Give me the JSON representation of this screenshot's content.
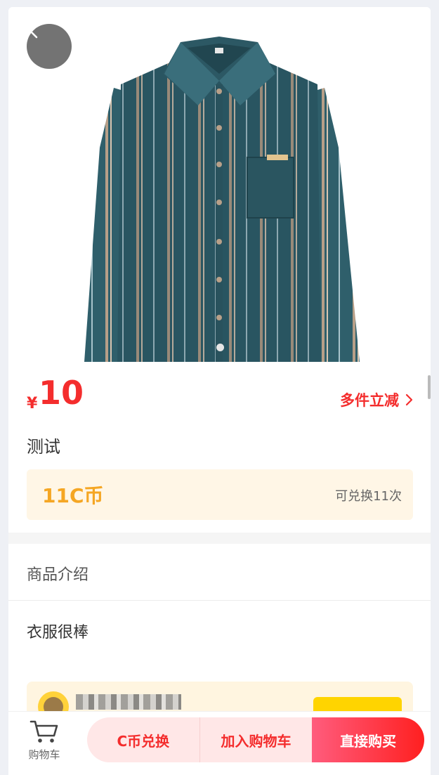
{
  "product": {
    "currency_symbol": "¥",
    "price": "10",
    "promo_label": "多件立减",
    "title": "测试",
    "coin_price": "11C币",
    "coin_exchange_note": "可兑换11次"
  },
  "gallery": {
    "image_name": "striped-shirt-photo",
    "dots": 1
  },
  "details": {
    "section_title": "商品介绍",
    "description": "衣服很棒"
  },
  "bottom_bar": {
    "cart_label": "购物车",
    "coin_exchange_label": "C币兑换",
    "add_to_cart_label": "加入购物车",
    "buy_now_label": "直接购买"
  },
  "colors": {
    "accent_red": "#f42d2d",
    "coin_orange": "#f5a623",
    "coin_bg": "#fff6e6",
    "shirt_teal": "#2f5f6b"
  },
  "icons": [
    "chevron-left-icon",
    "chevron-right-icon",
    "cart-icon"
  ]
}
